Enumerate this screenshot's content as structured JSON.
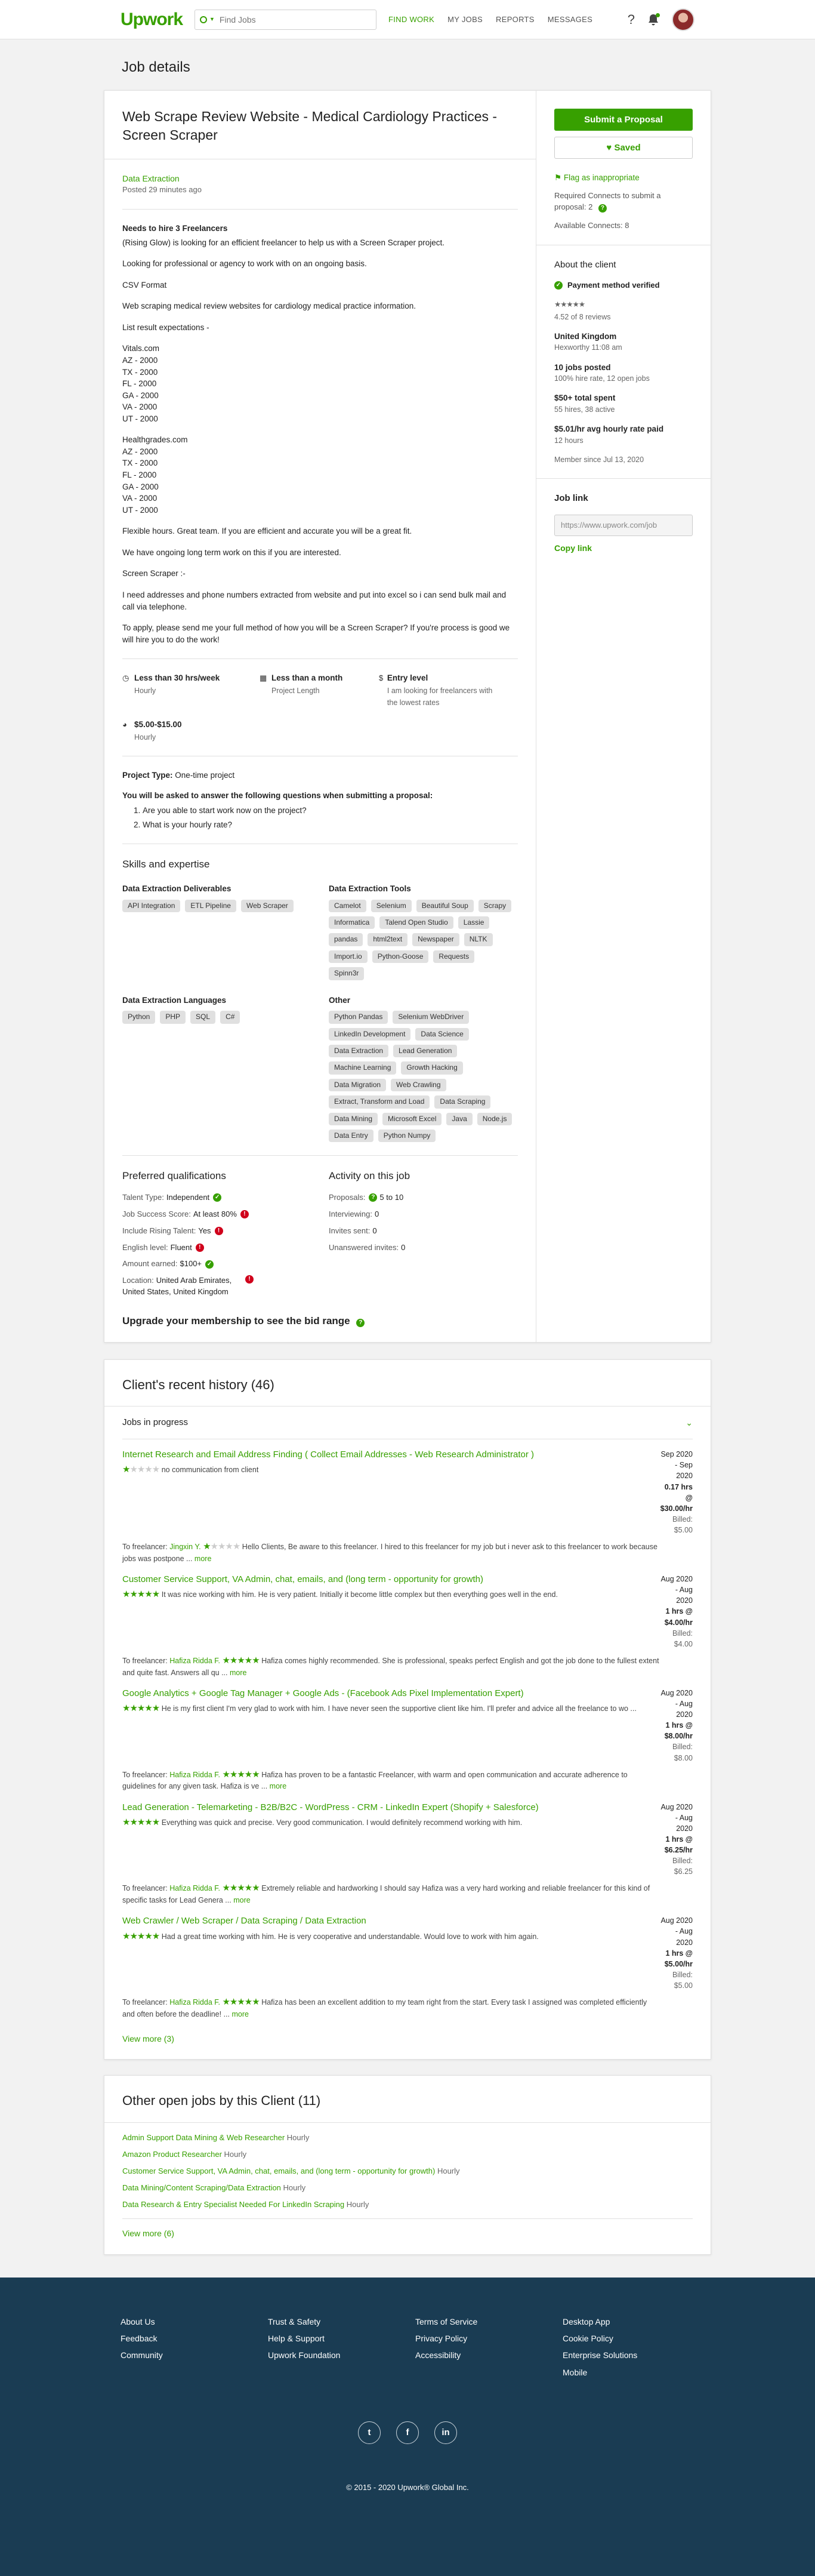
{
  "header": {
    "logo": "Upwork",
    "search_placeholder": "Find Jobs",
    "nav": [
      "FIND WORK",
      "MY JOBS",
      "REPORTS",
      "MESSAGES"
    ],
    "help": "?"
  },
  "page_title": "Job details",
  "job": {
    "title": "Web Scrape Review Website - Medical Cardiology Practices - Screen Scraper",
    "category": "Data Extraction",
    "posted": "Posted 29 minutes ago",
    "description": [
      {
        "text": "Needs to hire 3 Freelancers",
        "bold": true
      },
      {
        "text": "(Rising Glow) is looking for an efficient freelancer to help us with a Screen Scraper project."
      },
      {
        "text": "Looking for professional or agency to work with on an ongoing basis."
      },
      {
        "text": "CSV Format"
      },
      {
        "text": "Web scraping medical review websites for cardiology medical practice information."
      },
      {
        "text": "List result expectations -"
      },
      {
        "text": "Vitals.com\nAZ - 2000\nTX - 2000\nFL - 2000\nGA - 2000\nVA - 2000\nUT - 2000"
      },
      {
        "text": "Healthgrades.com\nAZ - 2000\nTX - 2000\nFL - 2000\nGA - 2000\nVA - 2000\nUT - 2000"
      },
      {
        "text": "Flexible hours. Great team. If you are efficient and accurate you will be a great fit."
      },
      {
        "text": "We have ongoing long term work on this if you are interested."
      },
      {
        "text": "Screen Scraper :-"
      },
      {
        "text": "I need addresses and phone numbers extracted from website and put into excel so i can send bulk mail and call via telephone."
      },
      {
        "text": "To apply, please send me your full method of how you will be a Screen Scraper? If you're process is good we will hire you to do the work!"
      }
    ],
    "facts": [
      {
        "icon": "clock-icon",
        "glyph": "◷",
        "title": "Less than 30 hrs/week",
        "sub": "Hourly"
      },
      {
        "icon": "calendar-icon",
        "glyph": "▦",
        "title": "Less than a month",
        "sub": "Project Length"
      },
      {
        "icon": "dollar-icon",
        "glyph": "$",
        "title": "Entry level",
        "sub": "I am looking for freelancers with the lowest rates"
      },
      {
        "icon": "clock-filled-icon",
        "glyph": "◕",
        "title": "$5.00-$15.00",
        "sub": "Hourly"
      }
    ],
    "project_type_label": "Project Type:",
    "project_type_value": "One-time project",
    "questions_title": "You will be asked to answer the following questions when submitting a proposal:",
    "questions": [
      "Are you able to start work now on the project?",
      "What is your hourly rate?"
    ],
    "skills_title": "Skills and expertise",
    "skill_groups": [
      {
        "name": "Data Extraction Deliverables",
        "tags": [
          "API Integration",
          "ETL Pipeline",
          "Web Scraper"
        ]
      },
      {
        "name": "Data Extraction Tools",
        "tags": [
          "Camelot",
          "Selenium",
          "Beautiful Soup",
          "Scrapy",
          "Informatica",
          "Talend Open Studio",
          "Lassie",
          "pandas",
          "html2text",
          "Newspaper",
          "NLTK",
          "Import.io",
          "Python-Goose",
          "Requests",
          "Spinn3r"
        ]
      },
      {
        "name": "Data Extraction Languages",
        "tags": [
          "Python",
          "PHP",
          "SQL",
          "C#"
        ]
      },
      {
        "name": "Other",
        "tags": [
          "Python Pandas",
          "Selenium WebDriver",
          "LinkedIn Development",
          "Data Science",
          "Data Extraction",
          "Lead Generation",
          "Machine Learning",
          "Growth Hacking",
          "Data Migration",
          "Web Crawling",
          "Extract, Transform and Load",
          "Data Scraping",
          "Data Mining",
          "Microsoft Excel",
          "Java",
          "Node.js",
          "Data Entry",
          "Python Numpy"
        ]
      }
    ],
    "prefs_title": "Preferred qualifications",
    "prefs": [
      {
        "label": "Talent Type:",
        "value": "Independent",
        "status": "ok"
      },
      {
        "label": "Job Success Score:",
        "value": "At least 80%",
        "status": "bad"
      },
      {
        "label": "Include Rising Talent:",
        "value": "Yes",
        "status": "bad"
      },
      {
        "label": "English level:",
        "value": "Fluent",
        "status": "bad"
      },
      {
        "label": "Amount earned:",
        "value": "$100+",
        "status": "ok"
      },
      {
        "label": "Location:",
        "value": "United Arab Emirates, United States, United Kingdom",
        "status": "bad"
      }
    ],
    "activity_title": "Activity on this job",
    "activity": [
      {
        "label": "Proposals:",
        "value": "5 to 10"
      },
      {
        "label": "Interviewing:",
        "value": "0"
      },
      {
        "label": "Invites sent:",
        "value": "0"
      },
      {
        "label": "Unanswered invites:",
        "value": "0"
      }
    ],
    "bid_range": "Upgrade your membership to see the bid range"
  },
  "sidebar": {
    "submit": "Submit a Proposal",
    "saved": "Saved",
    "flag": "Flag as inappropriate",
    "connects_required": "Required Connects to submit a proposal: 2",
    "connects_available": "Available Connects: 8",
    "about_title": "About the client",
    "payment": "Payment method verified",
    "rating_text": "4.52 of 8 reviews",
    "client_lines": [
      {
        "b": "United Kingdom",
        "s": "Hexworthy 11:08 am"
      },
      {
        "b": "10 jobs posted",
        "s": "100% hire rate, 12 open jobs"
      },
      {
        "b": "$50+ total spent",
        "s": "55 hires, 38 active"
      },
      {
        "b": "$5.01/hr avg hourly rate paid",
        "s": "12 hours"
      }
    ],
    "member_since": "Member since Jul 13, 2020",
    "job_link_title": "Job link",
    "job_link_value": "https://www.upwork.com/job",
    "copy_link": "Copy link"
  },
  "history": {
    "title": "Client's recent history (46)",
    "in_progress": "Jobs in progress",
    "items": [
      {
        "title": "Internet Research and Email Address Finding ( Collect Email Addresses - Web Research Administrator )",
        "dates": "Sep 2020 - Sep 2020",
        "rate": "0.17 hrs @ $30.00/hr",
        "billed": "Billed: $5.00",
        "client_stars": "★",
        "client_stars_off": "★★★★",
        "client_fb": "no communication from client",
        "to": "To freelancer:",
        "freelancer": "Jingxin Y.",
        "fl_stars": "★",
        "fl_stars_off": "★★★★",
        "fl_fb": "Hello Clients, Be aware to this freelancer. I hired to this freelancer for my job but i never ask to this freelancer to work because jobs was postpone ...",
        "more": "more"
      },
      {
        "title": "Customer Service Support, VA Admin, chat, emails, and (long term - opportunity for growth)",
        "dates": "Aug 2020 - Aug 2020",
        "rate": "1 hrs @ $4.00/hr",
        "billed": "Billed: $4.00",
        "client_stars": "★★★★★",
        "client_stars_off": "",
        "client_fb": "It was nice working with him. He is very patient. Initially it become little complex but then everything goes well in the end.",
        "to": "To freelancer:",
        "freelancer": "Hafiza Ridda F.",
        "fl_stars": "★★★★★",
        "fl_stars_off": "",
        "fl_fb": "Hafiza comes highly recommended. She is professional, speaks perfect English and got the job done to the fullest extent and quite fast. Answers all qu ...",
        "more": "more"
      },
      {
        "title": "Google Analytics + Google Tag Manager + Google Ads - (Facebook Ads Pixel Implementation Expert)",
        "dates": "Aug 2020 - Aug 2020",
        "rate": "1 hrs @ $8.00/hr",
        "billed": "Billed: $8.00",
        "client_stars": "★★★★★",
        "client_stars_off": "",
        "client_fb": "He is my first client I'm very glad to work with him. I have never seen the supportive client like him. I'll prefer and advice all the freelance to wo ...",
        "to": "To freelancer:",
        "freelancer": "Hafiza Ridda F.",
        "fl_stars": "★★★★★",
        "fl_stars_off": "",
        "fl_fb": "Hafiza has proven to be a fantastic Freelancer, with warm and open communication and accurate adherence to guidelines for any given task. Hafiza is ve ...",
        "more": "more"
      },
      {
        "title": "Lead Generation - Telemarketing - B2B/B2C - WordPress - CRM - LinkedIn Expert (Shopify + Salesforce)",
        "dates": "Aug 2020 - Aug 2020",
        "rate": "1 hrs @ $6.25/hr",
        "billed": "Billed: $6.25",
        "client_stars": "★★★★★",
        "client_stars_off": "",
        "client_fb": "Everything was quick and precise. Very good communication. I would definitely recommend working with him.",
        "to": "To freelancer:",
        "freelancer": "Hafiza Ridda F.",
        "fl_stars": "★★★★★",
        "fl_stars_off": "",
        "fl_fb": "Extremely reliable and hardworking I should say Hafiza was a very hard working and reliable freelancer for this kind of specific tasks for Lead Genera ...",
        "more": "more"
      },
      {
        "title": "Web Crawler / Web Scraper / Data Scraping / Data Extraction",
        "dates": "Aug 2020 - Aug 2020",
        "rate": "1 hrs @ $5.00/hr",
        "billed": "Billed: $5.00",
        "client_stars": "★★★★★",
        "client_stars_off": "",
        "client_fb": "Had a great time working with him. He is very cooperative and understandable. Would love to work with him again.",
        "to": "To freelancer:",
        "freelancer": "Hafiza Ridda F.",
        "fl_stars": "★★★★★",
        "fl_stars_off": "",
        "fl_fb": "Hafiza has been an excellent addition to my team right from the start. Every task I assigned was completed efficiently and often before the deadline! ...",
        "more": "more"
      }
    ],
    "view_more": "View more (3)"
  },
  "other_jobs": {
    "title": "Other open jobs by this Client (11)",
    "items": [
      {
        "title": "Admin Support Data Mining & Web Researcher",
        "rate": "Hourly"
      },
      {
        "title": "Amazon Product Researcher",
        "rate": "Hourly"
      },
      {
        "title": "Customer Service Support, VA Admin, chat, emails, and (long term - opportunity for growth)",
        "rate": "Hourly"
      },
      {
        "title": "Data Mining/Content Scraping/Data Extraction",
        "rate": "Hourly"
      },
      {
        "title": "Data Research & Entry Specialist Needed For LinkedIn Scraping",
        "rate": "Hourly"
      }
    ],
    "view_more": "View more (6)"
  },
  "footer": {
    "cols": [
      [
        "About Us",
        "Feedback",
        "Community"
      ],
      [
        "Trust & Safety",
        "Help & Support",
        "Upwork Foundation"
      ],
      [
        "Terms of Service",
        "Privacy Policy",
        "Accessibility"
      ],
      [
        "Desktop App",
        "Cookie Policy",
        "Enterprise Solutions",
        "Mobile"
      ]
    ],
    "social": [
      {
        "name": "twitter-icon",
        "glyph": "t"
      },
      {
        "name": "facebook-icon",
        "glyph": "f"
      },
      {
        "name": "linkedin-icon",
        "glyph": "in"
      }
    ],
    "copyright": "© 2015 - 2020 Upwork® Global Inc."
  },
  "colors": {
    "brand": "#37a000",
    "footer": "#1a3c53",
    "error": "#d0011b"
  }
}
